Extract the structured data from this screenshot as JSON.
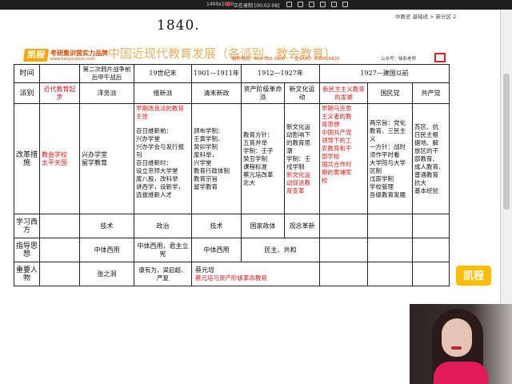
{
  "topbar": {
    "resolution": "1400x1050",
    "recording": "正在录制 [00:02:08]",
    "accent_record": "#ee3333"
  },
  "handwriting": "1840.",
  "watermark": {
    "brand": "考研集训营实力品牌",
    "url": "www.kaoyanjixun.com",
    "logo": "凯程"
  },
  "doc": {
    "title": "中国近现代教育发展（各派别、教会教育）",
    "hotline": "服务电话：400-050-3600",
    "qq": "企业QQ：800016820",
    "gzh": "公众号：徐影老师"
  },
  "panel": {
    "breadcrumb": "中教史 基础班 > 新分区 2",
    "icons": [
      "outline-icon",
      "more-icon"
    ]
  },
  "table": {
    "time_label": "时间",
    "times": [
      "",
      "第二次鸦片战争前后",
      "甲午战后",
      "19世纪末",
      "1901—1911年",
      "1912—1927年",
      "1927—建国以前"
    ],
    "faction_label": "派别",
    "factions": [
      "近代教育起步",
      "洋务派",
      "维新派",
      "清末新政",
      "资产阶级革命派",
      "新文化运动",
      "新民主主义教育的发端",
      "国民党",
      "共产党"
    ],
    "measures_label": "改革措施",
    "measures": {
      "start": [
        "教会学校",
        "太平天国"
      ],
      "yangwu": [
        "兴办学堂",
        "留学教育"
      ],
      "weixin_red": [
        "早期改良派的教育主张"
      ],
      "weixin": [
        "百日维新前：",
        "兴办学堂",
        "兴办学会与发行报刊",
        "百日维新时：",
        "设立京师大学堂",
        "废八股，改科举",
        "讲西学，设新学，",
        "选拔维新人才"
      ],
      "xinzheng": [
        "颁布学制：",
        "壬寅学制、",
        "癸卯学制",
        "废科举，",
        "兴学堂",
        "教育行政体制",
        "教育宗旨",
        "留学教育"
      ],
      "geming": [
        "教育方针：",
        "五育并举",
        "学制：壬子",
        "癸丑学制",
        "课程标准",
        "蔡元培改革",
        "北大"
      ],
      "xinwenhua": [
        "新文化运",
        "动影响下",
        "的教育思",
        "潮",
        "学制：壬",
        "戌学制"
      ],
      "xinwenhua_red": [
        "新文化运",
        "动促进教",
        "育变革"
      ],
      "xinminzhu": [
        "早期马克思",
        "主义者的教",
        "育思想",
        "中国共产党",
        "领导下的工",
        "农教育和干",
        "部学校",
        "国共合作时",
        "期的黄埔军",
        "校"
      ],
      "guomindang": [
        "两宗旨：党化",
        "教育、三民主",
        "义",
        "一方针：战时",
        "须作平时看",
        "大学院与大学",
        "区制",
        "戊辰学制",
        "学校管理",
        "各级教育发展"
      ],
      "gongchandang": [
        "苏区、抗",
        "日民主根",
        "据地、解",
        "放区的干",
        "部教育、",
        "成人教育、",
        "普通教育",
        "抗大",
        "基本经验"
      ]
    },
    "learn_label": "学习西方",
    "learn": [
      "技术",
      "政治",
      "技术",
      "国家政体",
      "观念革新"
    ],
    "guide_label": "指导思想",
    "guide": [
      "中体西用",
      "中体西用，君主立宪",
      "中体西用",
      "民主、共和"
    ],
    "people_label": "重要人物",
    "people": {
      "yangwu": "张之洞",
      "weixin": "康有为、梁启超、严复",
      "xinzheng": "蔡元培",
      "red_note": "蔡元培与资产阶级革命教育"
    }
  },
  "badge": "凯程",
  "colors": {
    "accent_red": "#e01818",
    "brand_orange": "#d64b00",
    "logo_yellow": "#f6a800"
  }
}
